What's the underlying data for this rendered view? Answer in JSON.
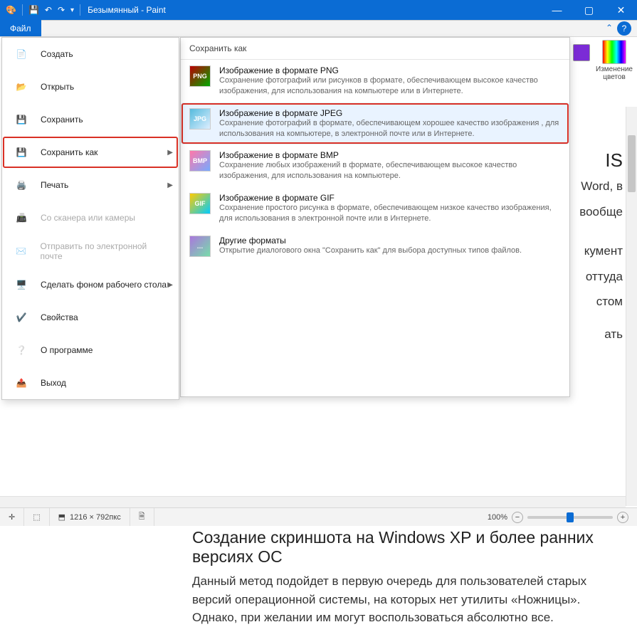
{
  "titlebar": {
    "title": "Безымянный - Paint",
    "undo_glyph": "↶",
    "redo_glyph": "↷"
  },
  "menubar": {
    "file": "Файл"
  },
  "ribbon_right": {
    "swatch_color": "#7b2bd6",
    "edit_colors": "Изменение\nцветов"
  },
  "file_menu": {
    "items": [
      {
        "key": "new",
        "label": "Создать",
        "interact": true,
        "arrow": false
      },
      {
        "key": "open",
        "label": "Открыть",
        "interact": true,
        "arrow": false
      },
      {
        "key": "save",
        "label": "Сохранить",
        "interact": true,
        "arrow": false
      },
      {
        "key": "saveas",
        "label": "Сохранить как",
        "interact": true,
        "arrow": true,
        "selected": true
      },
      {
        "key": "print",
        "label": "Печать",
        "interact": true,
        "arrow": true
      },
      {
        "key": "scanner",
        "label": "Со сканера или камеры",
        "interact": false,
        "arrow": false
      },
      {
        "key": "email",
        "label": "Отправить по электронной почте",
        "interact": false,
        "arrow": false
      },
      {
        "key": "wallpaper",
        "label": "Сделать фоном рабочего стола",
        "interact": true,
        "arrow": true
      },
      {
        "key": "props",
        "label": "Свойства",
        "interact": true,
        "arrow": false
      },
      {
        "key": "about",
        "label": "О программе",
        "interact": true,
        "arrow": false
      },
      {
        "key": "exit",
        "label": "Выход",
        "interact": true,
        "arrow": false
      }
    ]
  },
  "submenu": {
    "header": "Сохранить как",
    "items": [
      {
        "key": "png",
        "title": "Изображение в формате PNG",
        "desc": "Сохранение фотографий или рисунков в формате, обеспечивающем высокое качество изображения, для использования на компьютере или в Интернете.",
        "badge": "PNG",
        "thumb_bg1": "#b00",
        "thumb_bg2": "#0a0"
      },
      {
        "key": "jpeg",
        "title": "Изображение в формате JPEG",
        "desc": "Сохранение фотографий в формате, обеспечивающем хорошее качество изображения , для использования на компьютере, в электронной почте или в Интернете.",
        "selected": true,
        "badge": "JPG",
        "thumb_bg1": "#5bd",
        "thumb_bg2": "#def"
      },
      {
        "key": "bmp",
        "title": "Изображение в формате BMP",
        "desc": "Сохранение любых изображений в формате, обеспечивающем высокое качество изображения, для использования на компьютере.",
        "badge": "BMP",
        "thumb_bg1": "#f7a",
        "thumb_bg2": "#7af"
      },
      {
        "key": "gif",
        "title": "Изображение в формате GIF",
        "desc": "Сохранение простого рисунка в формате, обеспечивающем низкое качество изображения, для использования в электронной почте или в Интернете.",
        "badge": "GIF",
        "thumb_bg1": "#fc0",
        "thumb_bg2": "#0cf"
      },
      {
        "key": "other",
        "title": "Другие форматы",
        "desc": "Открытие диалогового окна \"Сохранить как\" для выбора доступных типов файлов.",
        "badge": "…",
        "thumb_bg1": "#a7d",
        "thumb_bg2": "#7da"
      }
    ]
  },
  "doc": {
    "h2_partial": "IS",
    "p1_partial_a": "Word, в",
    "p1_partial_b": "вообще",
    "p2_partial_a": "кумент",
    "p2_partial_b": "оттуда",
    "p2_partial_c": "стом",
    "p3_partial": "ать",
    "h3": "Создание скриншота на Windows XP и более ранних версиях ОС",
    "p4": "Данный метод подойдет в первую очередь для пользователей старых версий операционной системы, на которых нет утилиты «Ножницы». Однако, при желании им могут воспользоваться абсолютно все."
  },
  "status": {
    "cursor_glyph": "✛",
    "sel_glyph": "▭",
    "dim_glyph": "�отправ",
    "dims": "1216 × 792пкс",
    "size_glyph": "🗎",
    "zoom_label": "100%",
    "minus": "−",
    "plus": "+"
  }
}
